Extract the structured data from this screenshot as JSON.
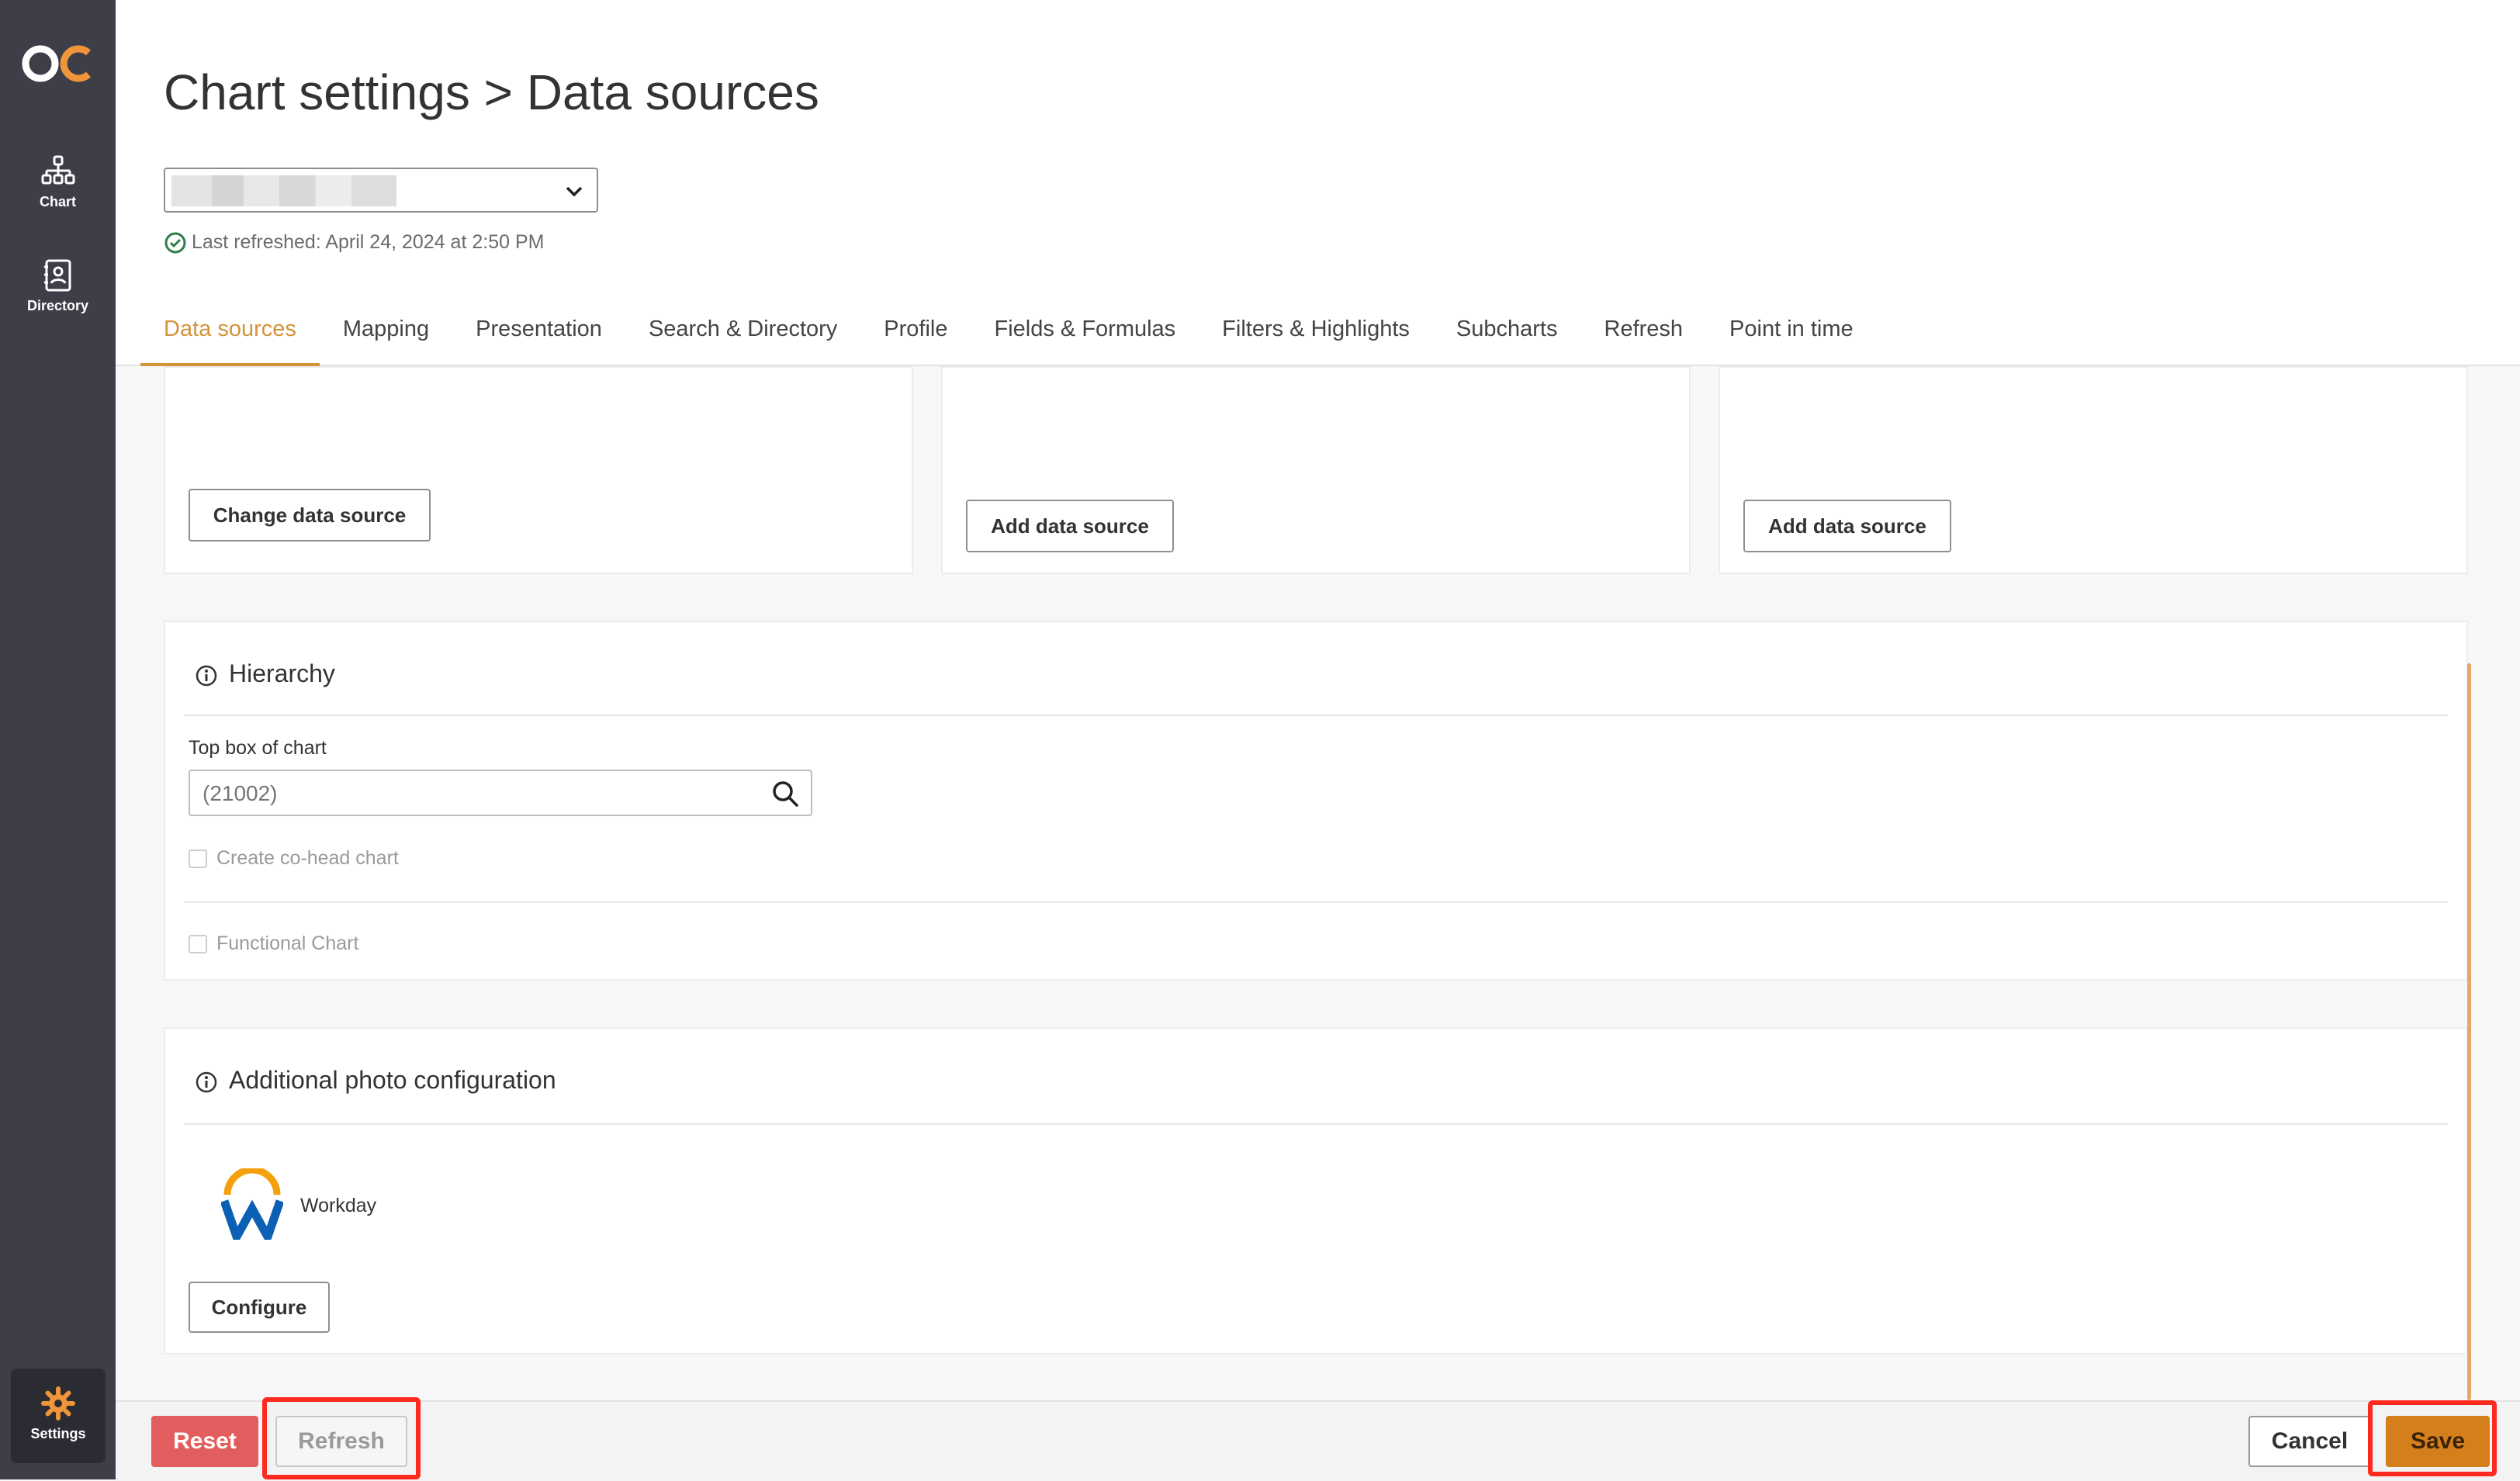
{
  "app": {
    "logo_text": "OC"
  },
  "nav": {
    "items": [
      {
        "label": "Chart",
        "icon": "org-chart-icon"
      },
      {
        "label": "Directory",
        "icon": "directory-icon"
      },
      {
        "label": "Settings",
        "icon": "gear-icon"
      }
    ]
  },
  "header": {
    "title": "Chart settings > Data sources",
    "chart_select_value": "",
    "last_refreshed": "Last refreshed: April 24, 2024 at 2:50 PM"
  },
  "tabs": [
    {
      "label": "Data sources",
      "active": true
    },
    {
      "label": "Mapping"
    },
    {
      "label": "Presentation"
    },
    {
      "label": "Search & Directory"
    },
    {
      "label": "Profile"
    },
    {
      "label": "Fields & Formulas"
    },
    {
      "label": "Filters & Highlights"
    },
    {
      "label": "Subcharts"
    },
    {
      "label": "Refresh"
    },
    {
      "label": "Point in time"
    }
  ],
  "data_sources": {
    "change_button": "Change data source",
    "add_button_1": "Add data source",
    "add_button_2": "Add data source"
  },
  "hierarchy": {
    "title": "Hierarchy",
    "top_box_label": "Top box of chart",
    "top_box_placeholder": "(21002)",
    "cohead_label": "Create co-head chart",
    "functional_label": "Functional Chart"
  },
  "photo_config": {
    "title": "Additional photo configuration",
    "provider_name": "Workday",
    "configure_button": "Configure"
  },
  "footer": {
    "reset": "Reset",
    "refresh": "Refresh",
    "cancel": "Cancel",
    "save": "Save"
  },
  "colors": {
    "accent": "#d4923a",
    "nav_bg": "#3d3e48",
    "reset_bg": "#e25d5d",
    "save_bg": "#d57f1c",
    "highlight": "#ff2a1f",
    "workday_orange": "#f5a00a",
    "workday_blue": "#0b5fb4"
  }
}
